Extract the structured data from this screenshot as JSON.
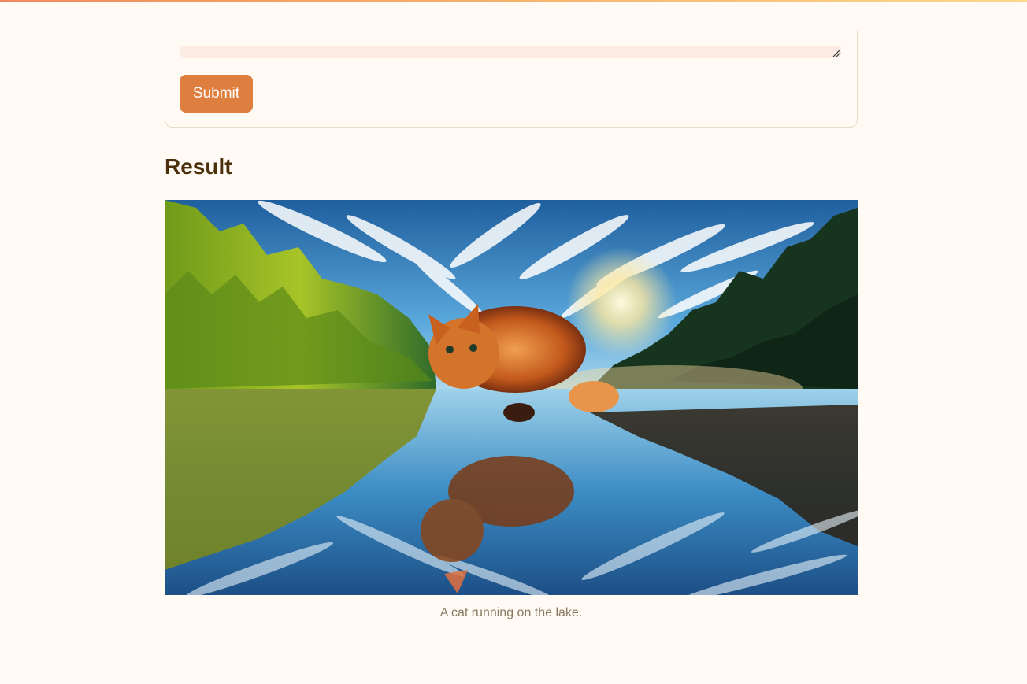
{
  "form": {
    "submit_label": "Submit"
  },
  "result": {
    "heading": "Result",
    "caption": "A cat running on the lake."
  },
  "colors": {
    "accent": "#df7f3f",
    "background": "#fffaf3",
    "heading": "#4a2f0a",
    "caption": "#8a7a62"
  },
  "icons": {
    "resize": "resize-handle-icon"
  }
}
